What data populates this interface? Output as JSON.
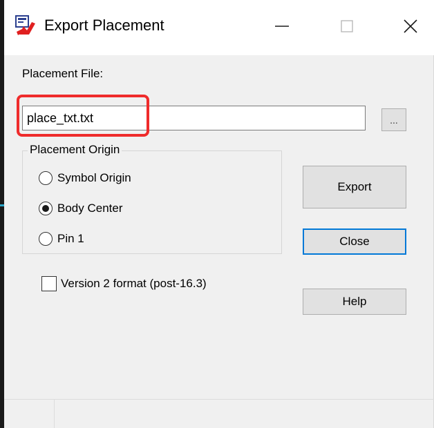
{
  "window": {
    "title": "Export Placement",
    "minimize_glyph": "—",
    "maximize_glyph": "☐",
    "close_glyph": "✕",
    "app_icon": "app-icon"
  },
  "placement_file": {
    "label": "Placement File:",
    "value": "place_txt.txt",
    "browse_label": "..."
  },
  "placement_origin": {
    "legend": "Placement Origin",
    "options": [
      {
        "label": "Symbol Origin",
        "selected": false
      },
      {
        "label": "Body Center",
        "selected": true
      },
      {
        "label": "Pin 1",
        "selected": false
      }
    ]
  },
  "version_option": {
    "label": "Version 2 format (post-16.3)",
    "checked": false
  },
  "buttons": {
    "export": "Export",
    "close": "Close",
    "help": "Help"
  },
  "colors": {
    "highlight": "#ef2b2b",
    "focus_border": "#0078d7",
    "dialog_bg": "#f0f0f0"
  }
}
